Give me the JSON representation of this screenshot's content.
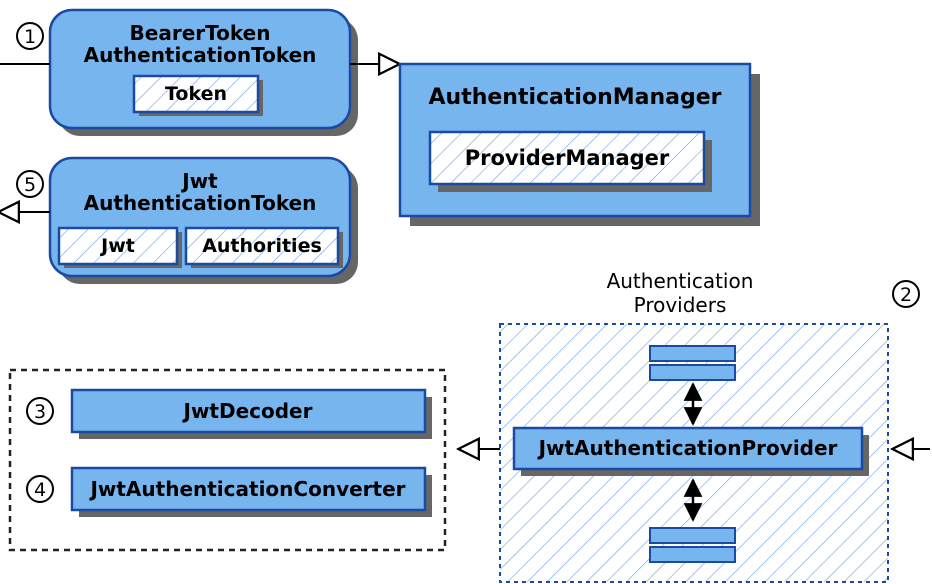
{
  "markers": {
    "m1": "1",
    "m2": "2",
    "m3": "3",
    "m4": "4",
    "m5": "5"
  },
  "bearerBox": {
    "line1": "BearerToken",
    "line2": "AuthenticationToken",
    "inner": "Token"
  },
  "jwtBox": {
    "line1": "Jwt",
    "line2": "AuthenticationToken",
    "innerLeft": "Jwt",
    "innerRight": "Authorities"
  },
  "authManager": {
    "title": "AuthenticationManager",
    "inner": "ProviderManager"
  },
  "providers": {
    "title1": "Authentication",
    "title2": "Providers",
    "main": "JwtAuthenticationProvider"
  },
  "decoderBox": "JwtDecoder",
  "converterBox": "JwtAuthenticationConverter"
}
